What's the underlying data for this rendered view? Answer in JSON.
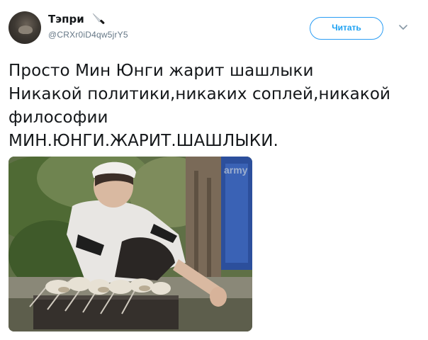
{
  "author": {
    "display_name": "Тэпри",
    "handle": "@CRXr0iD4qw5jrY5",
    "name_icon": "knife-icon"
  },
  "actions": {
    "follow_label": "Читать",
    "menu_icon": "chevron-down-icon"
  },
  "tweet": {
    "lines": [
      "Просто Мин Юнги жарит шашлыки",
      "Никакой политики,никаких соплей,никакой",
      "философии",
      "МИН.ЮНГИ.ЖАРИТ.ШАШЛЫКИ."
    ]
  },
  "media": {
    "watermark": "army"
  },
  "colors": {
    "accent": "#1da1f2",
    "text": "#14171a",
    "secondary": "#657786"
  }
}
